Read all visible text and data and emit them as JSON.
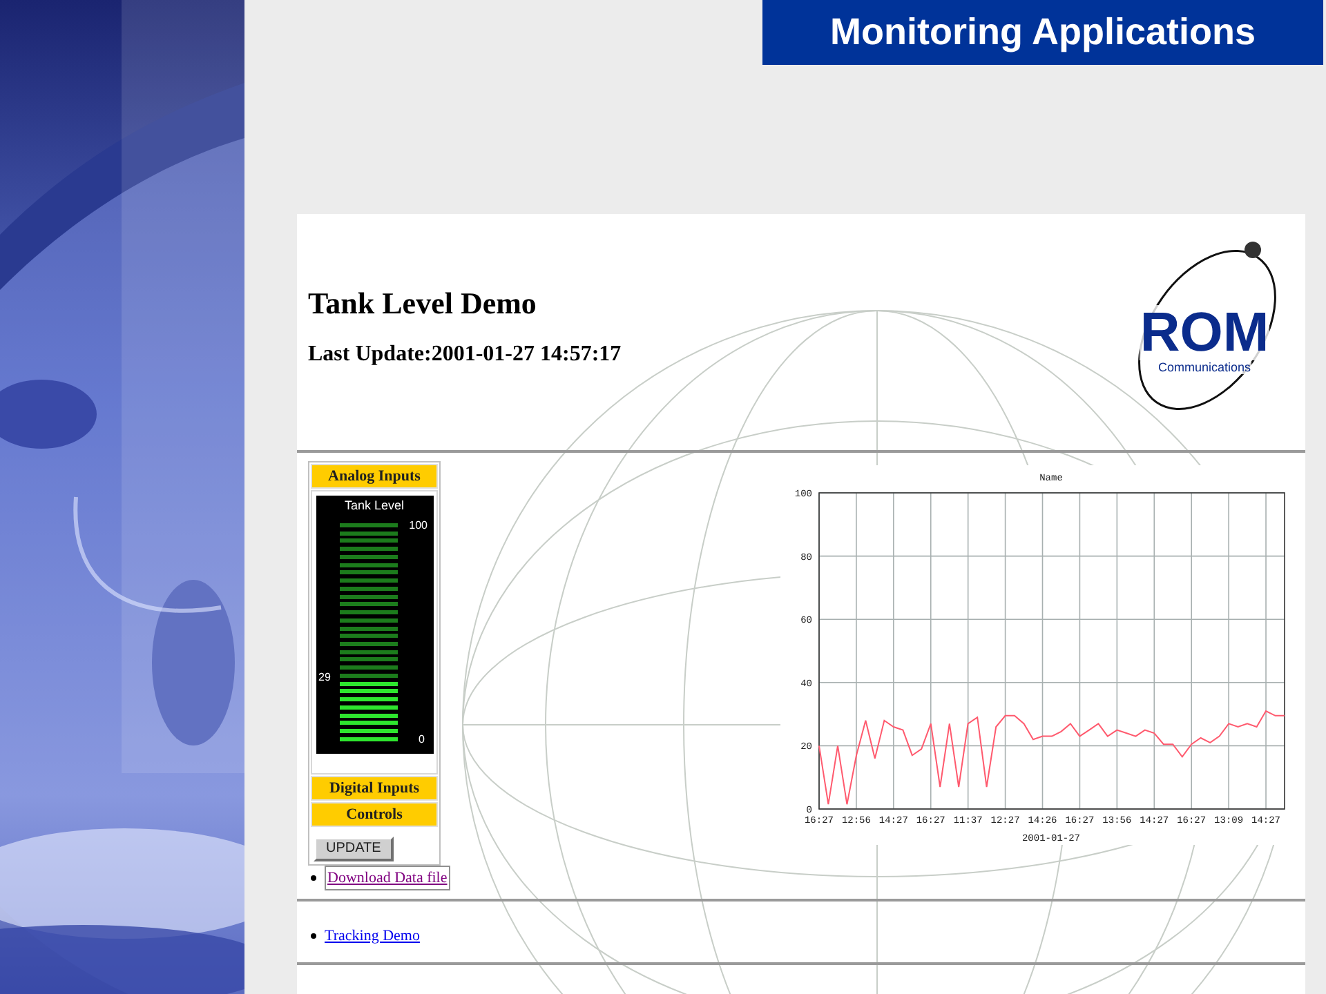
{
  "slide": {
    "kind": "picture",
    "title": "Monitoring Applications"
  },
  "page": {
    "heading": "Tank Level Demo",
    "last_update": "Last Update:2001-01-27 14:57:17",
    "logo": {
      "name": "ROM",
      "tagline": "Communications"
    },
    "panel": {
      "sections": [
        {
          "label": "Analog Inputs"
        },
        {
          "label": "Digital Inputs"
        },
        {
          "label": "Controls"
        }
      ],
      "gauge": {
        "title": "Tank Level",
        "max_label": "100",
        "min_label": "0",
        "reading": "29",
        "level": 0.29
      },
      "button": "UPDATE"
    },
    "chart_data": {
      "type": "line",
      "title": "Name",
      "xlabel": "2001-01-27",
      "grid": true,
      "ylim": [
        0,
        100
      ],
      "categories": [
        "16:27",
        null,
        null,
        null,
        "12:56",
        null,
        null,
        null,
        "14:27",
        null,
        null,
        null,
        "16:27",
        null,
        null,
        null,
        "11:37",
        null,
        null,
        null,
        "12:27",
        null,
        null,
        null,
        "14:26",
        null,
        null,
        null,
        "16:27",
        null,
        null,
        null,
        "13:56",
        null,
        null,
        null,
        "14:27",
        null,
        null,
        null,
        "16:27",
        null,
        null,
        null,
        "13:09",
        null,
        null,
        null,
        "14:27",
        null,
        null
      ],
      "yticks": [
        0,
        20,
        40,
        60,
        80,
        100
      ],
      "series": [
        {
          "color": "#ff5a6e",
          "values": [
            20,
            1.5,
            20,
            1.5,
            17,
            28,
            16,
            28,
            26,
            25,
            17,
            19,
            27,
            7,
            27,
            7,
            27,
            29,
            7,
            26,
            29.5,
            29.5,
            27,
            22,
            23,
            23,
            24.5,
            27,
            23,
            25,
            27,
            23,
            25,
            24,
            23,
            25,
            24,
            20.5,
            20.5,
            16.5,
            20.5,
            22.5,
            21,
            23,
            27,
            26,
            27,
            26,
            31,
            29.5,
            29.5
          ]
        }
      ]
    },
    "links": [
      {
        "label": "Download Data file",
        "visited": true
      },
      {
        "label": "Tracking Demo",
        "visited": false
      }
    ]
  }
}
